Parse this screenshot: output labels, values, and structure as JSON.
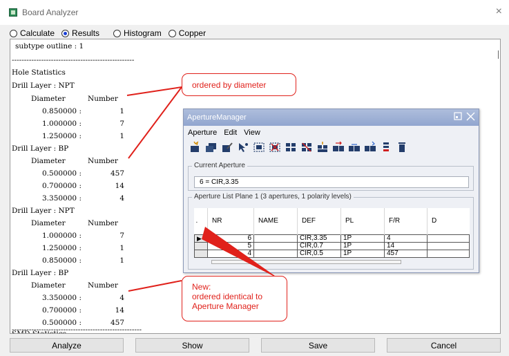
{
  "window": {
    "title": "Board Analyzer",
    "close_glyph": "×"
  },
  "modes": [
    {
      "label": "Calculate",
      "selected": false
    },
    {
      "label": "Results",
      "selected": true
    },
    {
      "label": "Histogram",
      "selected": false
    },
    {
      "label": "Copper",
      "selected": false
    }
  ],
  "report": {
    "subtype_line": "subtype outline : 1",
    "separator": "--------------------------------------------------",
    "hole_statistics": "Hole Statistics",
    "col_diameter": "Diameter",
    "col_number": "Number",
    "sections": [
      {
        "layer": "Drill Layer : NPT",
        "rows": [
          [
            "0.850000 :",
            "1"
          ],
          [
            "1.000000 :",
            "7"
          ],
          [
            "1.250000 :",
            "1"
          ]
        ]
      },
      {
        "layer": "Drill Layer : BP",
        "rows": [
          [
            "0.500000 :",
            "457"
          ],
          [
            "0.700000 :",
            "14"
          ],
          [
            "3.350000 :",
            "4"
          ]
        ]
      },
      {
        "layer": "Drill Layer : NPT",
        "rows": [
          [
            "1.000000 :",
            "7"
          ],
          [
            "1.250000 :",
            "1"
          ],
          [
            "0.850000 :",
            "1"
          ]
        ]
      },
      {
        "layer": "Drill Layer : BP",
        "rows": [
          [
            "3.350000 :",
            "4"
          ],
          [
            "0.700000 :",
            "14"
          ],
          [
            "0.500000 :",
            "457"
          ]
        ]
      }
    ],
    "separator2": "-----------------------------------------------------",
    "smd_statistics": "SMD Statistics"
  },
  "buttons": {
    "analyze": "Analyze",
    "show": "Show",
    "save": "Save",
    "cancel": "Cancel"
  },
  "callouts": {
    "ordered_by_diameter": "ordered by diameter",
    "new_line1": "New:",
    "new_line2": "ordered identical to",
    "new_line3": "Aperture Manager"
  },
  "aperture_manager": {
    "title": "ApertureManager",
    "menu": [
      "Aperture",
      "Edit",
      "View"
    ],
    "current_aperture_label": "Current Aperture",
    "current_aperture_value": "6 = CIR,3.35",
    "list_label": "Aperture List Plane 1 (3 apertures, 1 polarity levels)",
    "columns": [
      ".",
      "NR",
      "NAME",
      "DEF",
      "PL",
      "F/R",
      "D"
    ],
    "rows": [
      {
        "nr": "6",
        "name": "",
        "def": "CIR,3.35",
        "pl": "1P",
        "fr": "4",
        "d": ""
      },
      {
        "nr": "5",
        "name": "",
        "def": "CIR,0.7",
        "pl": "1P",
        "fr": "14",
        "d": ""
      },
      {
        "nr": "4",
        "name": "",
        "def": "CIR,0.5",
        "pl": "1P",
        "fr": "457",
        "d": ""
      }
    ],
    "toolbar_icons": [
      "new-aperture-icon",
      "copy-aperture-icon",
      "edit-aperture-icon",
      "pick-aperture-icon",
      "select-icon",
      "delete-selection-icon",
      "grid-icon",
      "grid-delete-icon",
      "import-icon",
      "move-right-icon",
      "move-left-icon",
      "sort-icon",
      "list-icon",
      "trash-icon"
    ]
  },
  "colors": {
    "callout": "#e0211b",
    "selected_radio": "#1a3fd6",
    "am_title": "#9fb2d6"
  }
}
